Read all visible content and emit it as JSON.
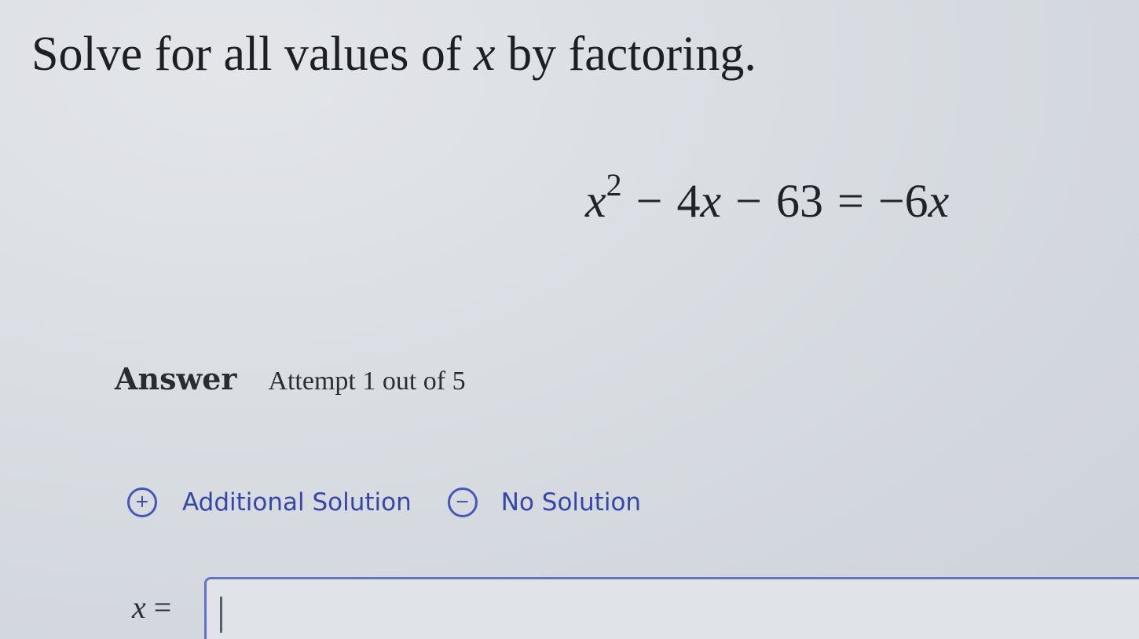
{
  "question": {
    "prefix": "Solve for all values of ",
    "variable": "x",
    "suffix": " by factoring."
  },
  "equation": {
    "term1_var": "x",
    "term1_exp": "2",
    "op1": "−",
    "term2": "4",
    "term2_var": "x",
    "op2": "−",
    "term3": "63",
    "equals": "=",
    "rhs": "−6",
    "rhs_var": "x"
  },
  "answer": {
    "label": "Answer",
    "attempt": "Attempt 1 out of 5"
  },
  "options": {
    "additional": {
      "label": "Additional Solution",
      "icon": "+"
    },
    "none": {
      "label": "No Solution",
      "icon": "−"
    }
  },
  "input": {
    "variable": "x",
    "equals": "=",
    "value": ""
  },
  "colors": {
    "accent": "#3447a6",
    "input_border": "#6374c6"
  }
}
